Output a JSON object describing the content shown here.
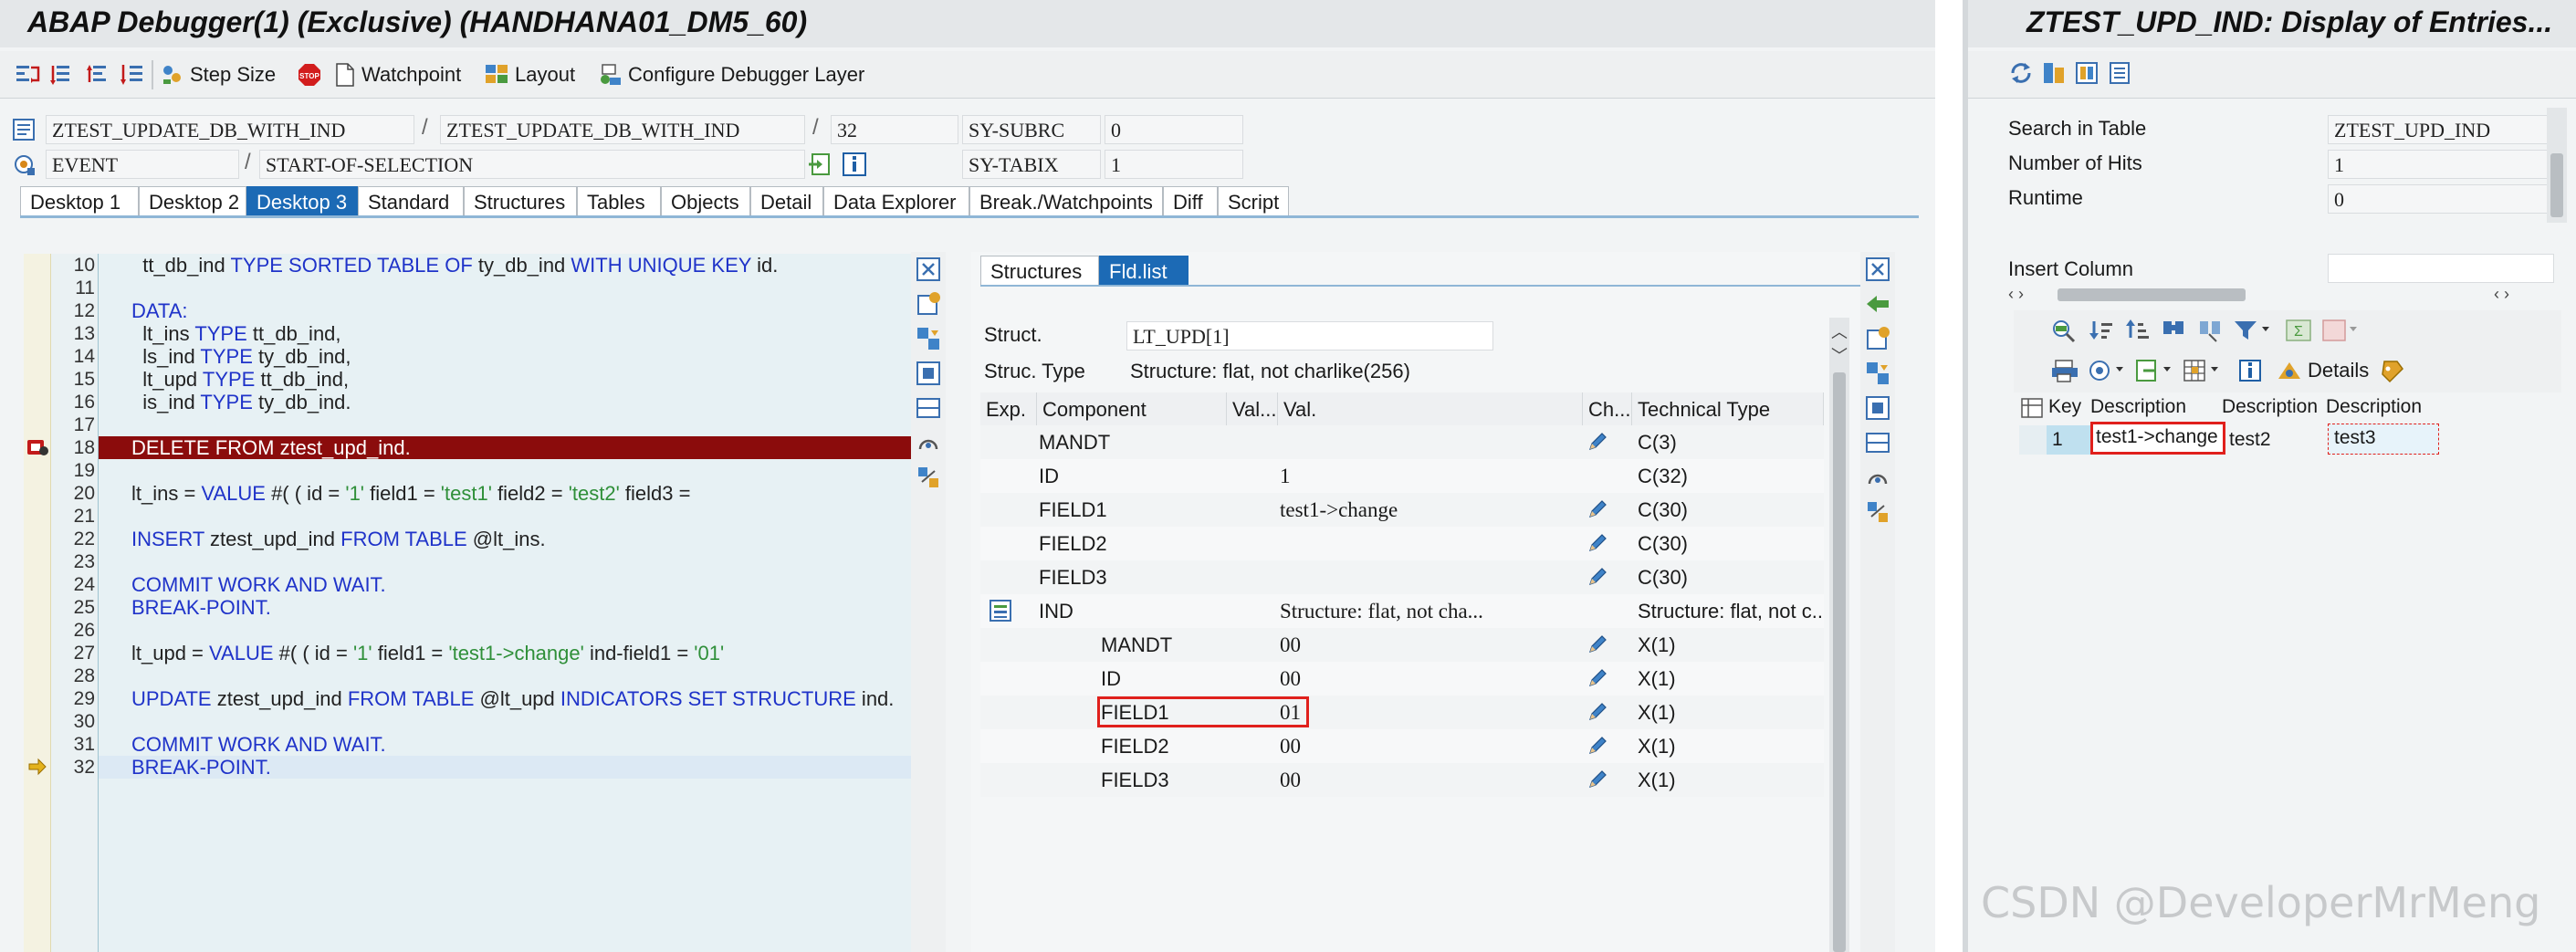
{
  "debugger": {
    "title": "ABAP Debugger(1)  (Exclusive) (HANDHANA01_DM5_60)",
    "toolbar": {
      "step_size": "Step Size",
      "watchpoint": "Watchpoint",
      "layout": "Layout",
      "configure": "Configure Debugger Layer"
    },
    "info": {
      "program": "ZTEST_UPDATE_DB_WITH_IND",
      "include": "ZTEST_UPDATE_DB_WITH_IND",
      "sep": "/",
      "line": "32",
      "event_type": "EVENT",
      "event": "START-OF-SELECTION",
      "subrc_label": "SY-SUBRC",
      "subrc_value": "0",
      "tabix_label": "SY-TABIX",
      "tabix_value": "1"
    },
    "tabs": [
      "Desktop 1",
      "Desktop 2",
      "Desktop 3",
      "Standard",
      "Structures",
      "Tables",
      "Objects",
      "Detail",
      "Data Explorer",
      "Break./Watchpoints",
      "Diff",
      "Script"
    ],
    "code": [
      {
        "no": "10",
        "tokens": [
          [
            "id",
            "  tt_db_ind "
          ],
          [
            "kw",
            "TYPE SORTED TABLE OF"
          ],
          [
            "id",
            " ty_db_ind "
          ],
          [
            "kw",
            "WITH UNIQUE KEY"
          ],
          [
            "id",
            " id."
          ]
        ]
      },
      {
        "no": "11",
        "tokens": []
      },
      {
        "no": "12",
        "tokens": [
          [
            "kw",
            "DATA:"
          ]
        ]
      },
      {
        "no": "13",
        "tokens": [
          [
            "id",
            "  lt_ins "
          ],
          [
            "kw",
            "TYPE"
          ],
          [
            "id",
            " tt_db_ind,"
          ]
        ]
      },
      {
        "no": "14",
        "tokens": [
          [
            "id",
            "  ls_ind "
          ],
          [
            "kw",
            "TYPE"
          ],
          [
            "id",
            " ty_db_ind,"
          ]
        ]
      },
      {
        "no": "15",
        "tokens": [
          [
            "id",
            "  lt_upd "
          ],
          [
            "kw",
            "TYPE"
          ],
          [
            "id",
            " tt_db_ind,"
          ]
        ]
      },
      {
        "no": "16",
        "tokens": [
          [
            "id",
            "  is_ind "
          ],
          [
            "kw",
            "TYPE"
          ],
          [
            "id",
            " ty_db_ind."
          ]
        ]
      },
      {
        "no": "17",
        "tokens": []
      },
      {
        "no": "18",
        "tokens": [
          [
            "del",
            "DELETE FROM ztest_upd_ind."
          ]
        ]
      },
      {
        "no": "19",
        "tokens": []
      },
      {
        "no": "20",
        "tokens": [
          [
            "id",
            "lt_ins = "
          ],
          [
            "kw",
            "VALUE"
          ],
          [
            "id",
            " #( ( id = "
          ],
          [
            "str",
            "'1'"
          ],
          [
            "id",
            " field1 = "
          ],
          [
            "str",
            "'test1'"
          ],
          [
            "id",
            " field2 = "
          ],
          [
            "str",
            "'test2'"
          ],
          [
            "id",
            " field3 = "
          ]
        ]
      },
      {
        "no": "21",
        "tokens": []
      },
      {
        "no": "22",
        "tokens": [
          [
            "kw",
            "INSERT"
          ],
          [
            "id",
            " ztest_upd_ind "
          ],
          [
            "kw",
            "FROM TABLE"
          ],
          [
            "id",
            " @lt_ins."
          ]
        ]
      },
      {
        "no": "23",
        "tokens": []
      },
      {
        "no": "24",
        "tokens": [
          [
            "kw",
            "COMMIT WORK AND WAIT."
          ]
        ]
      },
      {
        "no": "25",
        "tokens": [
          [
            "kw",
            "BREAK-POINT."
          ]
        ]
      },
      {
        "no": "26",
        "tokens": []
      },
      {
        "no": "27",
        "tokens": [
          [
            "id",
            "lt_upd = "
          ],
          [
            "kw",
            "VALUE"
          ],
          [
            "id",
            " #( ( id = "
          ],
          [
            "str",
            "'1'"
          ],
          [
            "id",
            " field1 = "
          ],
          [
            "str",
            "'test1->change'"
          ],
          [
            "id",
            " ind-field1 = "
          ],
          [
            "str",
            "'01'"
          ]
        ]
      },
      {
        "no": "28",
        "tokens": []
      },
      {
        "no": "29",
        "tokens": [
          [
            "kw",
            "UPDATE"
          ],
          [
            "id",
            " ztest_upd_ind "
          ],
          [
            "kw",
            "FROM TABLE"
          ],
          [
            "id",
            " @lt_upd "
          ],
          [
            "kw",
            "INDICATORS SET STRUCTURE"
          ],
          [
            "id",
            " ind."
          ]
        ]
      },
      {
        "no": "30",
        "tokens": []
      },
      {
        "no": "31",
        "tokens": [
          [
            "kw",
            "COMMIT WORK AND WAIT."
          ]
        ]
      },
      {
        "no": "32",
        "tokens": [
          [
            "kw",
            "BREAK-POINT."
          ]
        ]
      }
    ],
    "fld": {
      "tabs": [
        "Structures",
        "Fld.list"
      ],
      "struct_label": "Struct.",
      "struct_value": "LT_UPD[1]",
      "struct_type_label": "Struc. Type",
      "struct_type_value": "Structure: flat, not charlike(256)",
      "headers": [
        "Exp.",
        "Component",
        "Val...",
        "Val.",
        "Ch...",
        "Technical Type"
      ],
      "rows": [
        {
          "component": "MANDT",
          "value": "",
          "edit": true,
          "type": "C(3)",
          "indent": false
        },
        {
          "component": "ID",
          "value": "1",
          "edit": false,
          "type": "C(32)",
          "indent": false
        },
        {
          "component": "FIELD1",
          "value": "test1->change",
          "edit": true,
          "type": "C(30)",
          "indent": false
        },
        {
          "component": "FIELD2",
          "value": "",
          "edit": true,
          "type": "C(30)",
          "indent": false
        },
        {
          "component": "FIELD3",
          "value": "",
          "edit": true,
          "type": "C(30)",
          "indent": false
        },
        {
          "component": "IND",
          "value": "Structure: flat, not cha...",
          "edit": false,
          "type": "Structure: flat, not c...",
          "indent": false,
          "expand": true
        },
        {
          "component": "MANDT",
          "value": "00",
          "edit": true,
          "type": "X(1)",
          "indent": true
        },
        {
          "component": "ID",
          "value": "00",
          "edit": true,
          "type": "X(1)",
          "indent": true
        },
        {
          "component": "FIELD1",
          "value": "01",
          "edit": true,
          "type": "X(1)",
          "indent": true,
          "boxed": true
        },
        {
          "component": "FIELD2",
          "value": "00",
          "edit": true,
          "type": "X(1)",
          "indent": true
        },
        {
          "component": "FIELD3",
          "value": "00",
          "edit": true,
          "type": "X(1)",
          "indent": true
        }
      ]
    }
  },
  "se16": {
    "title": "ZTEST_UPD_IND: Display of Entries...",
    "search_label": "Search in Table",
    "search_value": "ZTEST_UPD_IND",
    "hits_label": "Number of Hits",
    "hits_value": "1",
    "runtime_label": "Runtime",
    "runtime_value": "0",
    "insert_label": "Insert Column",
    "details_label": "Details",
    "headers": [
      "Key",
      "Description",
      "Description",
      "Description"
    ],
    "row": {
      "key": "1",
      "d1": "test1->change",
      "d2": "test2",
      "d3": "test3"
    }
  },
  "watermark": "CSDN @DeveloperMrMeng"
}
